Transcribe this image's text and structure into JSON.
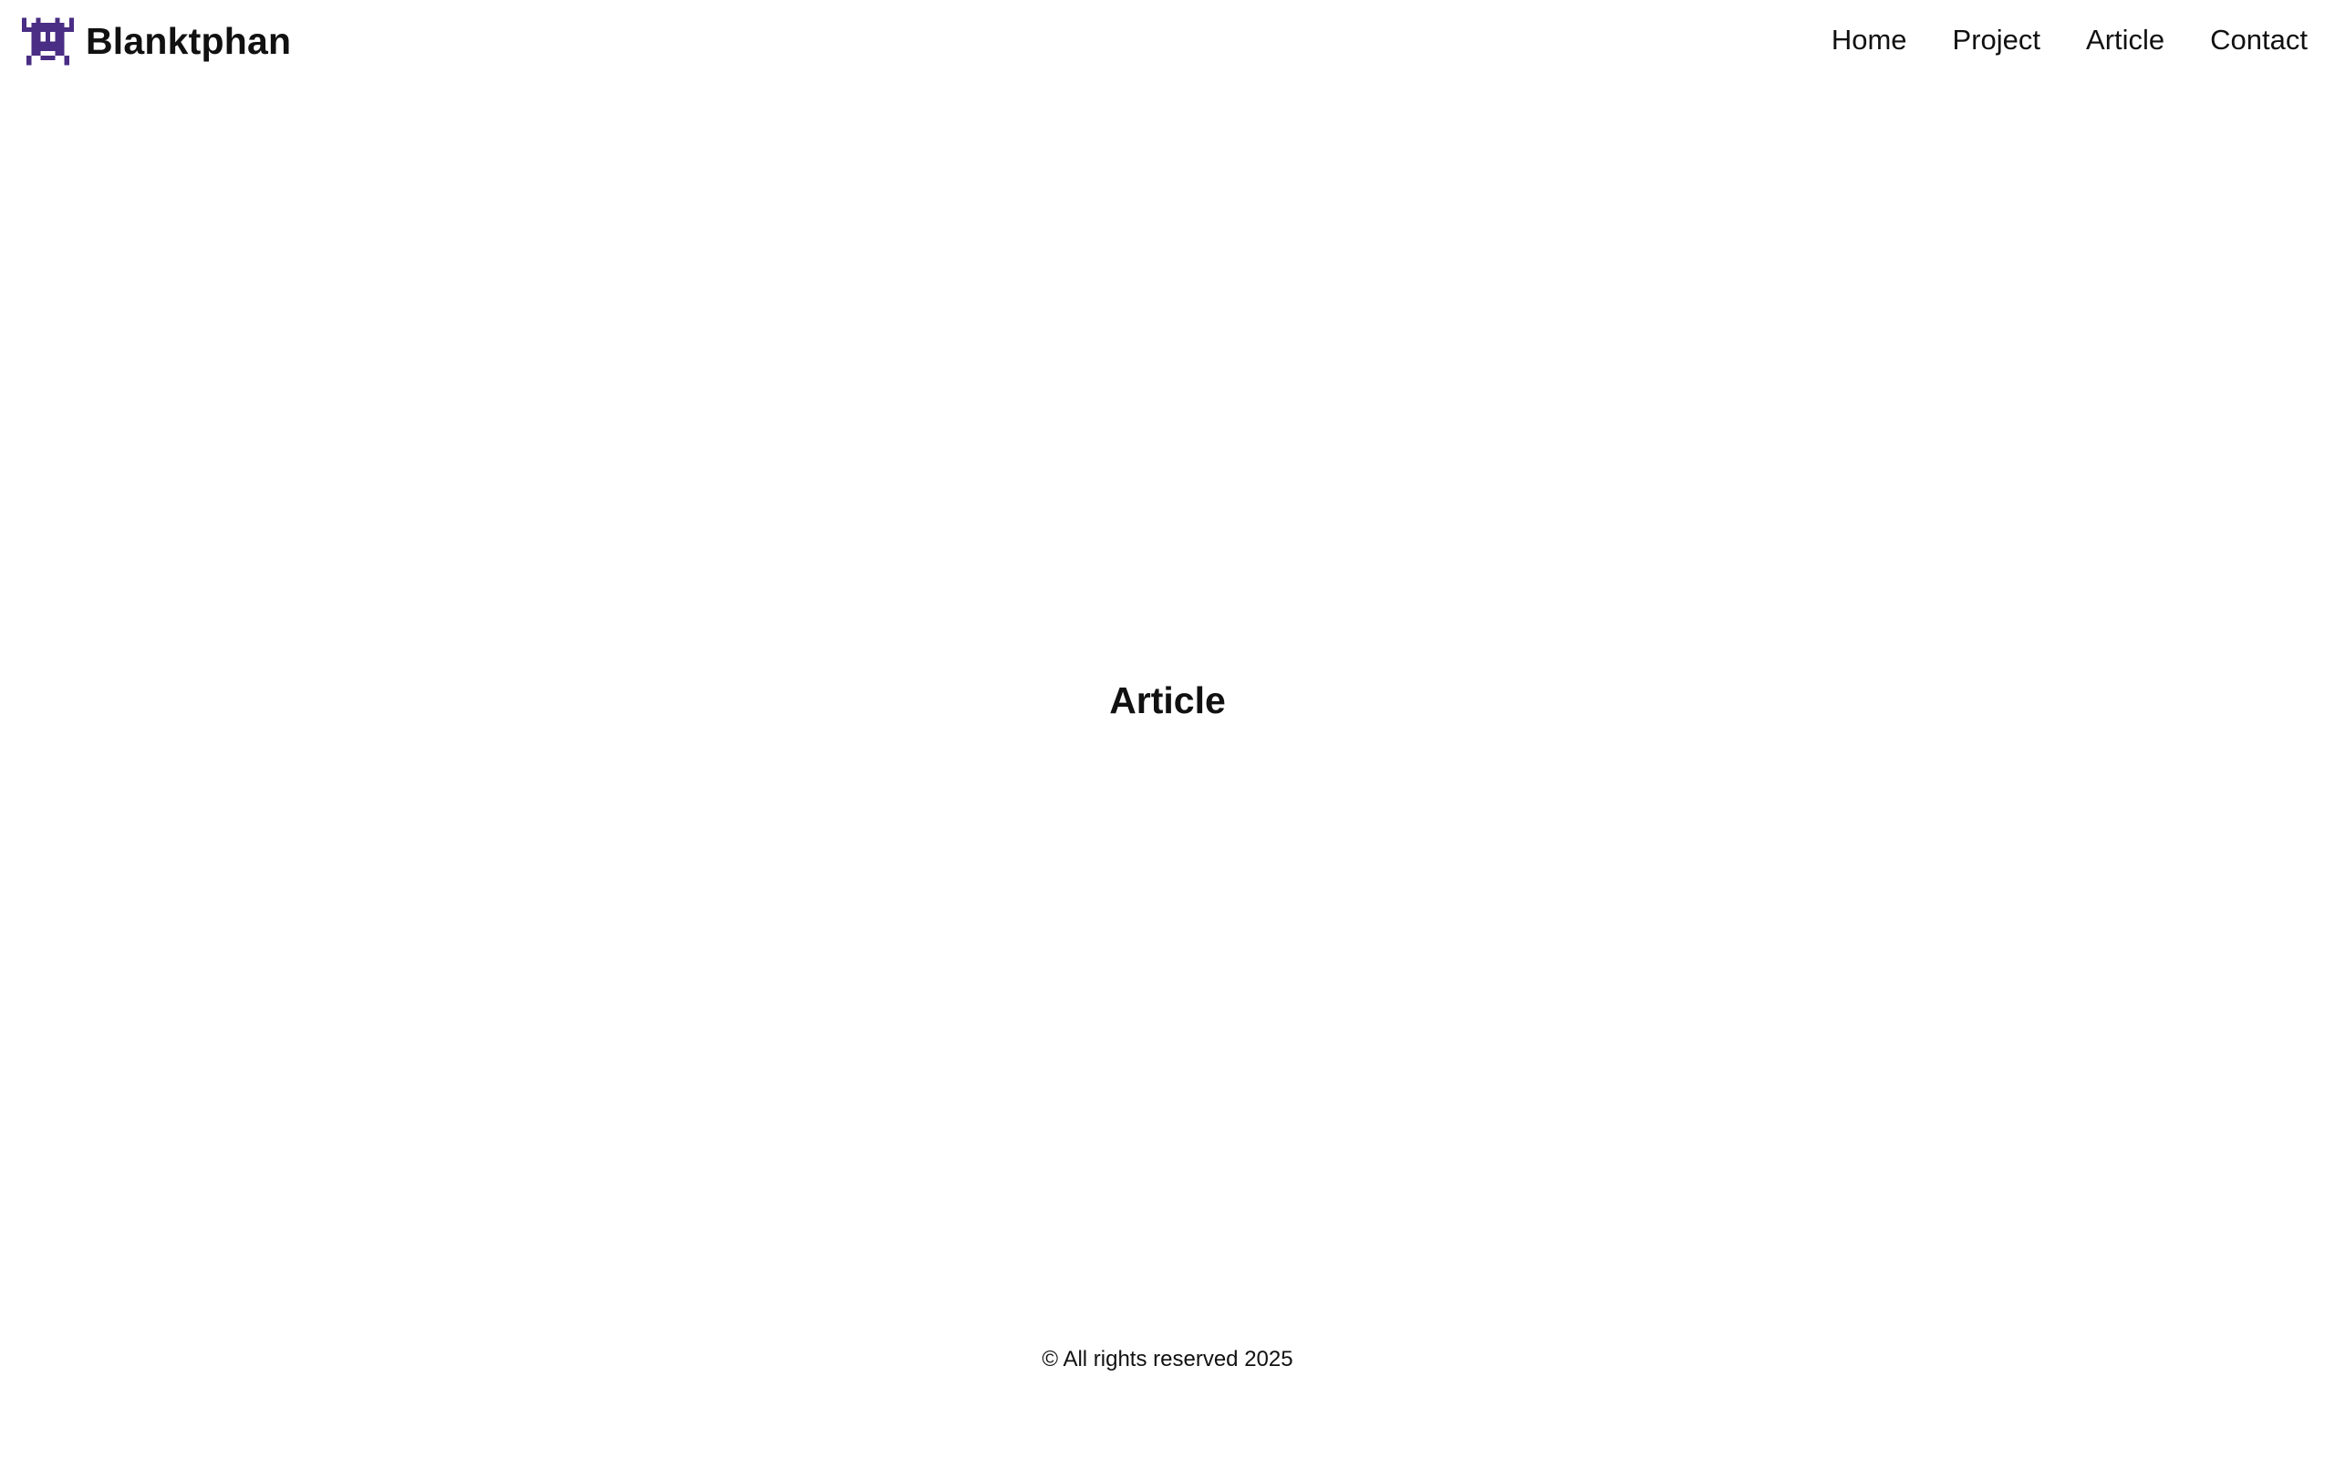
{
  "header": {
    "brand": {
      "name": "Blanktphan",
      "logo_icon": "pixel-alien-invader-icon",
      "logo_color": "#4a2d84"
    },
    "nav": [
      {
        "label": "Home"
      },
      {
        "label": "Project"
      },
      {
        "label": "Article"
      },
      {
        "label": "Contact"
      }
    ]
  },
  "main": {
    "heading": "Article"
  },
  "footer": {
    "copyright": "© All rights reserved 2025"
  }
}
